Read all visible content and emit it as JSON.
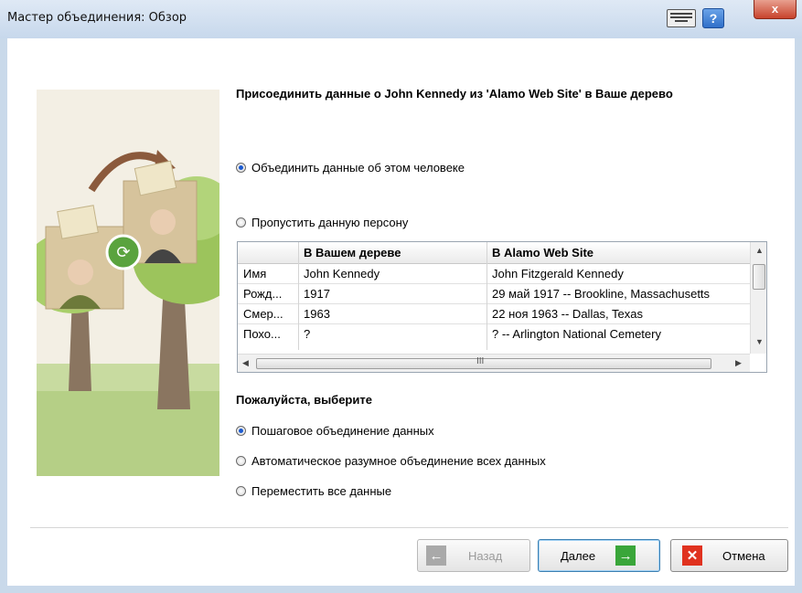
{
  "window": {
    "title": "Мастер объединения: Обзор",
    "help_label": "?",
    "close_label": "x"
  },
  "heading": "Присоединить данные о John Kennedy из 'Alamo Web Site' в Ваше дерево",
  "options_top": [
    {
      "label": "Объединить данные об этом человеке",
      "selected": true
    },
    {
      "label": "Пропустить данную персону",
      "selected": false
    }
  ],
  "table": {
    "headers": [
      "",
      "В Вашем дереве",
      "В Alamo Web Site"
    ],
    "rows": [
      [
        "Имя",
        "John Kennedy",
        "John Fitzgerald Kennedy"
      ],
      [
        "Рожд...",
        "1917",
        "29 май 1917 -- Brookline, Massachusetts"
      ],
      [
        "Смер...",
        "1963",
        "22 ноя 1963 -- Dallas, Texas"
      ],
      [
        "Похо...",
        "?",
        "? -- Arlington National Cemetery"
      ]
    ],
    "hscroll_grip": "III"
  },
  "choose_label": "Пожалуйста, выберите",
  "options_bottom": [
    {
      "label": "Пошаговое объединение данных",
      "selected": true
    },
    {
      "label": "Автоматическое разумное объединение всех данных",
      "selected": false
    },
    {
      "label": "Переместить все данные",
      "selected": false
    }
  ],
  "buttons": {
    "back": "Назад",
    "next": "Далее",
    "cancel": "Отмена"
  },
  "colors": {
    "accent_green": "#3aa63a",
    "cancel_red": "#e0321f",
    "disabled_gray": "#9b9b9b"
  }
}
